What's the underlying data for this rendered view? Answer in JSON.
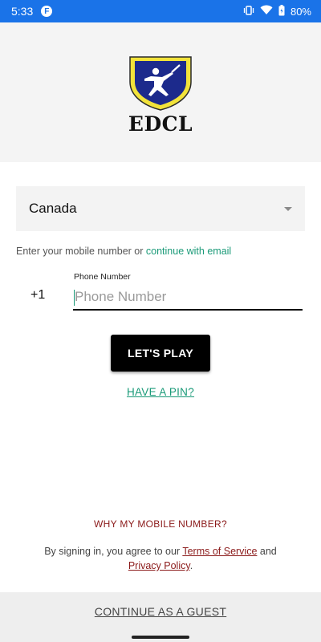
{
  "status_bar": {
    "time": "5:33",
    "app_notif_letter": "F",
    "battery": "80%",
    "icons": [
      "vibrate-icon",
      "wifi-icon",
      "battery-icon"
    ]
  },
  "logo": {
    "text": "EDCL",
    "colors": {
      "shield_outer": "#f2e33a",
      "shield_inner": "#1c2a8c",
      "figure": "#ffffff"
    }
  },
  "form": {
    "country_value": "Canada",
    "helper_prefix": "Enter your mobile number or",
    "helper_link": "continue with email",
    "country_code": "+1",
    "phone_label": "Phone Number",
    "phone_placeholder": "Phone Number",
    "play_button": "LET'S PLAY",
    "have_pin": "HAVE A PIN?"
  },
  "footer": {
    "why_mobile": "WHY MY MOBILE NUMBER?",
    "terms_prefix": "By signing in, you agree to our",
    "terms_link": "Terms of Service",
    "terms_and": "and",
    "privacy_link": "Privacy Policy",
    "privacy_suffix": ".",
    "guest": "CONTINUE AS A GUEST"
  },
  "colors": {
    "status_bar": "#1a73e8",
    "accent": "#1a9a78",
    "link_red": "#8b1a1a",
    "button": "#000000"
  }
}
